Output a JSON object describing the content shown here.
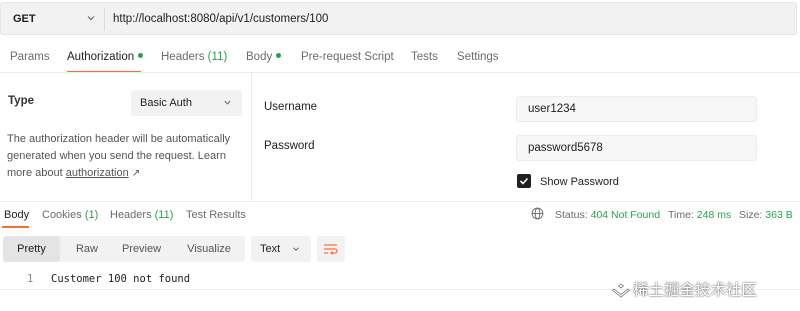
{
  "request": {
    "method": "GET",
    "url": "http://localhost:8080/api/v1/customers/100"
  },
  "req_tabs": {
    "params": "Params",
    "authorization": "Authorization",
    "headers": "Headers",
    "headers_count": "(11)",
    "body": "Body",
    "prerequest": "Pre-request Script",
    "tests": "Tests",
    "settings": "Settings"
  },
  "auth": {
    "type_label": "Type",
    "type_value": "Basic Auth",
    "desc_prefix": "The authorization header will be automatically generated when you send the request. Learn more about ",
    "desc_link": "authorization",
    "username_label": "Username",
    "username_value": "user1234",
    "password_label": "Password",
    "password_value": "password5678",
    "show_password_label": "Show Password",
    "show_password_checked": true
  },
  "resp_tabs": {
    "body": "Body",
    "cookies": "Cookies",
    "cookies_count": "(1)",
    "headers": "Headers",
    "headers_count": "(11)",
    "test_results": "Test Results"
  },
  "status": {
    "status_label": "Status:",
    "status_value": "404 Not Found",
    "time_label": "Time:",
    "time_value": "248 ms",
    "size_label": "Size:",
    "size_value": "363 B"
  },
  "view": {
    "pretty": "Pretty",
    "raw": "Raw",
    "preview": "Preview",
    "visualize": "Visualize",
    "format": "Text"
  },
  "response_body": {
    "line_number": "1",
    "line_text": "Customer 100 not found"
  },
  "watermark": "稀土掘金技术社区",
  "colors": {
    "accent": "#ff6c37",
    "success": "#26a24f"
  }
}
